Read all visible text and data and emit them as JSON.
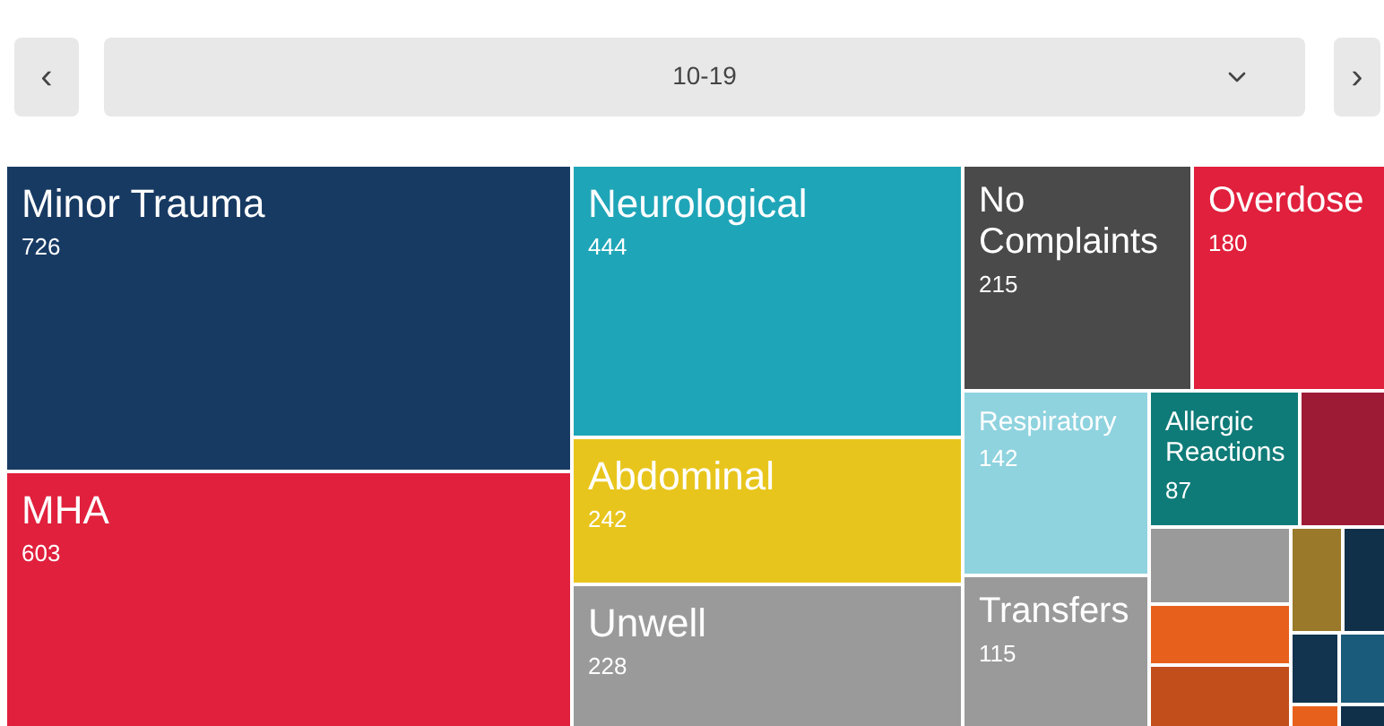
{
  "controls": {
    "prev": "‹",
    "select": {
      "value": "10-19"
    },
    "next": "›"
  },
  "treemap": {
    "tiles": [
      {
        "label": "Minor Trauma",
        "value": "726",
        "color": "#173a63"
      },
      {
        "label": "MHA",
        "value": "603",
        "color": "#e0203c"
      },
      {
        "label": "Neurological",
        "value": "444",
        "color": "#1fa5b8"
      },
      {
        "label": "Abdominal",
        "value": "242",
        "color": "#e8c51c"
      },
      {
        "label": "Unwell",
        "value": "228",
        "color": "#9a9a9a"
      },
      {
        "label": "No Complaints",
        "value": "215",
        "color": "#4a4a4a"
      },
      {
        "label": "Overdose",
        "value": "180",
        "color": "#e0203c"
      },
      {
        "label": "Respiratory",
        "value": "142",
        "color": "#8fd3df"
      },
      {
        "label": "Transfers",
        "value": "115",
        "color": "#9a9a9a"
      },
      {
        "label": "Allergic Reactions",
        "value": "87",
        "color": "#0f7b78"
      },
      {
        "color": "#9e1b36"
      },
      {
        "color": "#9a9a9a"
      },
      {
        "color": "#e8611c"
      },
      {
        "color": "#c24e1c"
      },
      {
        "color": "#9a7a2a"
      },
      {
        "color": "#10304a"
      },
      {
        "color": "#12344e"
      },
      {
        "color": "#1a5a7a"
      },
      {
        "color": "#e8611c"
      },
      {
        "color": "#10304a"
      }
    ]
  }
}
